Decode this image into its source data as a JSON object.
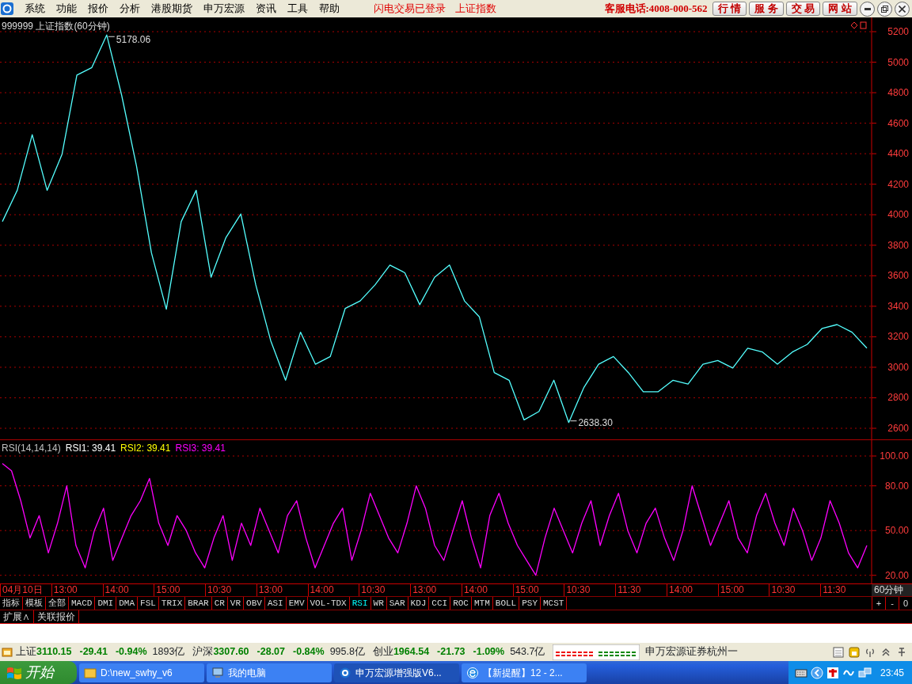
{
  "menu": [
    "系统",
    "功能",
    "报价",
    "分析",
    "港股期货",
    "申万宏源",
    "资讯",
    "工具",
    "帮助"
  ],
  "notices": [
    "闪电交易已登录",
    "上证指数"
  ],
  "hotline": "客服电话:4008-000-562",
  "service_buttons": [
    "行 情",
    "服 务",
    "交 易",
    "网 站"
  ],
  "price_panel": {
    "title": "999999 上证指数(60分钟)",
    "chart_data": {
      "type": "line",
      "ylim": [
        2600,
        5200
      ],
      "yticks": [
        2600,
        2800,
        3000,
        3200,
        3400,
        3600,
        3800,
        4000,
        4200,
        4400,
        4600,
        4800,
        5000,
        5200
      ],
      "grid": true,
      "series": [
        {
          "color": "#54ffff",
          "values": [
            3955,
            4160,
            4525,
            4160,
            4395,
            4915,
            4965,
            5178,
            4785,
            4320,
            3750,
            3380,
            3955,
            4160,
            3590,
            3850,
            4005,
            3540,
            3175,
            2915,
            3230,
            3020,
            3070,
            3385,
            3435,
            3540,
            3670,
            3620,
            3410,
            3590,
            3670,
            3435,
            3330,
            2965,
            2915,
            2655,
            2710,
            2915,
            2638,
            2865,
            3020,
            3070,
            2965,
            2840,
            2840,
            2915,
            2890,
            3020,
            3045,
            2995,
            3125,
            3100,
            3020,
            3100,
            3150,
            3255,
            3280,
            3230,
            3125
          ]
        }
      ],
      "annotations": [
        "5178.06",
        "2638.30"
      ]
    }
  },
  "rsi_panel": {
    "legend": [
      {
        "text": "RSI(14,14,14)",
        "kind": "params"
      },
      {
        "text": "RSI1: 39.41",
        "kind": "rsi1"
      },
      {
        "text": "RSI2: 39.41",
        "kind": "rsi2"
      },
      {
        "text": "RSI3: 39.41",
        "kind": "rsi3"
      }
    ],
    "chart_data": {
      "type": "line",
      "ylim": [
        14,
        100
      ],
      "grid": true,
      "yticks": [
        {
          "value": 20,
          "label": "20.00"
        },
        {
          "value": 50,
          "label": "50.00"
        },
        {
          "value": 80,
          "label": "80.00"
        },
        {
          "value": 100,
          "label": "100.00"
        }
      ],
      "series": [
        {
          "color": "#ff00ff",
          "values": [
            95,
            90,
            70,
            45,
            60,
            35,
            55,
            80,
            40,
            25,
            50,
            65,
            30,
            45,
            60,
            70,
            85,
            55,
            40,
            60,
            50,
            35,
            25,
            45,
            60,
            30,
            55,
            40,
            65,
            50,
            35,
            60,
            70,
            45,
            25,
            40,
            55,
            65,
            30,
            50,
            75,
            60,
            45,
            35,
            55,
            80,
            65,
            40,
            30,
            50,
            70,
            45,
            25,
            60,
            75,
            55,
            40,
            30,
            20,
            45,
            65,
            50,
            35,
            55,
            70,
            40,
            60,
            75,
            50,
            35,
            55,
            65,
            45,
            30,
            50,
            80,
            60,
            40,
            55,
            70,
            45,
            35,
            60,
            75,
            55,
            40,
            65,
            50,
            30,
            45,
            70,
            55,
            35,
            25,
            40
          ]
        }
      ]
    }
  },
  "time_axis": {
    "labels": [
      "04月10日",
      "13:00",
      "14:00",
      "15:00",
      "10:30",
      "13:00",
      "14:00",
      "10:30",
      "13:00",
      "14:00",
      "15:00",
      "10:30",
      "11:30",
      "14:00",
      "15:00",
      "10:30",
      "11:30"
    ],
    "period": "60分钟"
  },
  "indicator_tabs": [
    {
      "label": "指标",
      "selected": false
    },
    {
      "label": "模板",
      "selected": false
    },
    {
      "label": "全部",
      "selected": false
    },
    {
      "label": "MACD",
      "selected": false
    },
    {
      "label": "DMI",
      "selected": false
    },
    {
      "label": "DMA",
      "selected": false
    },
    {
      "label": "FSL",
      "selected": false
    },
    {
      "label": "TRIX",
      "selected": false
    },
    {
      "label": "BRAR",
      "selected": false
    },
    {
      "label": "CR",
      "selected": false
    },
    {
      "label": "VR",
      "selected": false
    },
    {
      "label": "OBV",
      "selected": false
    },
    {
      "label": "ASI",
      "selected": false
    },
    {
      "label": "EMV",
      "selected": false
    },
    {
      "label": "VOL-TDX",
      "selected": false
    },
    {
      "label": "RSI",
      "selected": true
    },
    {
      "label": "WR",
      "selected": false
    },
    {
      "label": "SAR",
      "selected": false
    },
    {
      "label": "KDJ",
      "selected": false
    },
    {
      "label": "CCI",
      "selected": false
    },
    {
      "label": "ROC",
      "selected": false
    },
    {
      "label": "MTM",
      "selected": false
    },
    {
      "label": "BOLL",
      "selected": false
    },
    {
      "label": "PSY",
      "selected": false
    },
    {
      "label": "MCST",
      "selected": false
    }
  ],
  "zoom_buttons": [
    "+",
    "-",
    "0"
  ],
  "extra_tabs": [
    "扩展∧",
    "关联报价"
  ],
  "indices": [
    {
      "name": "上证",
      "value": "3110.15",
      "change": "-29.41",
      "percent": "-0.94%",
      "turnover": "1893亿"
    },
    {
      "name": "沪深",
      "value": "3307.60",
      "change": "-28.07",
      "percent": "-0.84%",
      "turnover": "995.8亿"
    },
    {
      "name": "创业",
      "value": "1964.54",
      "change": "-21.73",
      "percent": "-1.09%",
      "turnover": "543.7亿"
    }
  ],
  "broker": "申万宏源证券杭州一",
  "taskbar": {
    "start": "开始",
    "tasks": [
      {
        "label": "D:\\new_swhy_v6",
        "kind": "folder",
        "selected": false
      },
      {
        "label": "我的电脑",
        "kind": "computer",
        "selected": false
      },
      {
        "label": "申万宏源增强版V6...",
        "kind": "app",
        "selected": true
      },
      {
        "label": "【新提醒】12 - 2...",
        "kind": "browser",
        "selected": false
      }
    ],
    "clock": "23:45"
  }
}
